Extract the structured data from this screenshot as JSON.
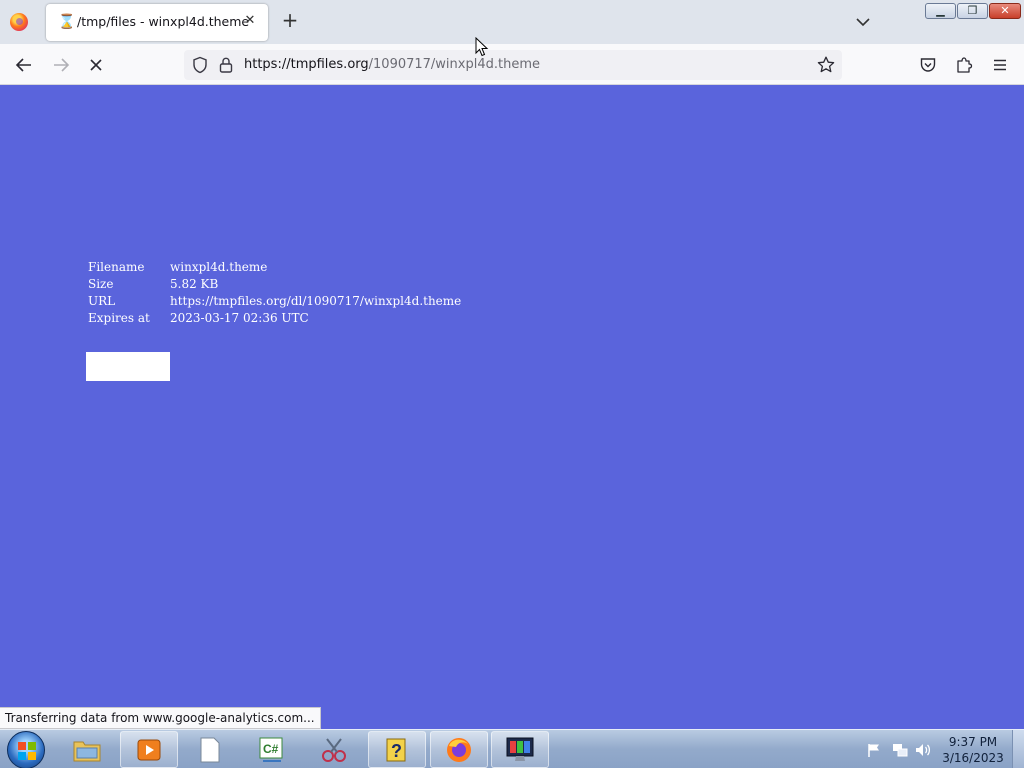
{
  "browser": {
    "tab": {
      "title": "/tmp/files - winxpl4d.theme"
    },
    "url": {
      "host": "https://tmpfiles.org",
      "path": "/1090717/winxpl4d.theme"
    },
    "status_text": "Transferring data from www.google-analytics.com..."
  },
  "file_info": {
    "rows": [
      {
        "key": "Filename",
        "value": "winxpl4d.theme"
      },
      {
        "key": "Size",
        "value": "5.82 KB"
      },
      {
        "key": "URL",
        "value": "https://tmpfiles.org/dl/1090717/winxpl4d.theme"
      },
      {
        "key": "Expires at",
        "value": "2023-03-17 02:36 UTC"
      }
    ]
  },
  "colors": {
    "page_background": "#5a64dc",
    "text": "#ffffff"
  },
  "taskbar": {
    "clock_time": "9:37 PM",
    "clock_date": "3/16/2023"
  }
}
